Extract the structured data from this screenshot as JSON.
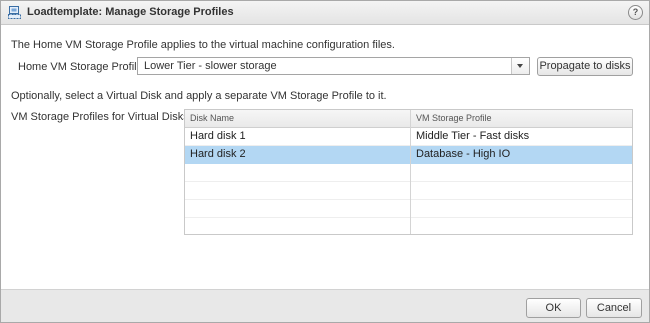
{
  "dialog": {
    "title": "Loadtemplate: Manage Storage Profiles",
    "title_icon": "vm-template-icon",
    "help_label": "?"
  },
  "home_profile": {
    "description": "The Home VM Storage Profile applies to the virtual machine configuration files.",
    "label": "Home VM Storage Profile:",
    "selected_value": "Lower Tier - slower storage",
    "propagate_label": "Propagate to disks"
  },
  "disk_section": {
    "description": "Optionally, select a Virtual Disk and apply a separate VM Storage Profile to it.",
    "label": "VM Storage Profiles for Virtual Disks:",
    "columns": [
      "Disk Name",
      "VM Storage Profile"
    ],
    "rows": [
      {
        "disk": "Hard disk 1",
        "profile": "Middle Tier - Fast disks",
        "selected": false
      },
      {
        "disk": "Hard disk 2",
        "profile": "Database - High IO",
        "selected": true
      }
    ],
    "selected_row_color": "#b3d7f3"
  },
  "footer": {
    "ok_label": "OK",
    "cancel_label": "Cancel"
  }
}
